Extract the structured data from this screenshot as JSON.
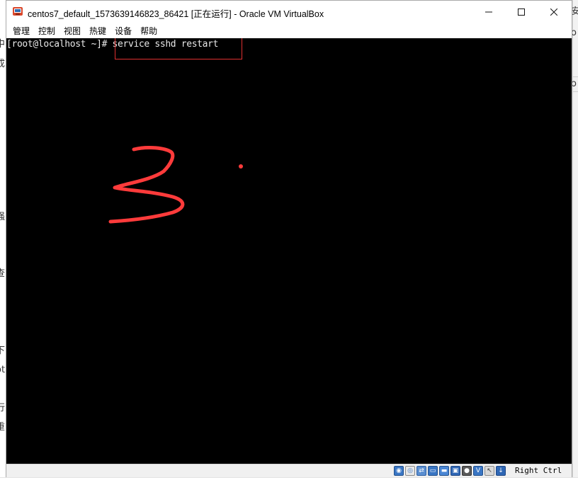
{
  "window": {
    "title": "centos7_default_1573639146823_86421 [正在运行] - Oracle VM VirtualBox",
    "minimize_icon": "minimize-icon",
    "maximize_icon": "maximize-icon",
    "close_icon": "close-icon"
  },
  "menu": {
    "items": [
      "管理",
      "控制",
      "视图",
      "热键",
      "设备",
      "帮助"
    ]
  },
  "terminal": {
    "prompt": "[root@localhost ~]# ",
    "command": "service sshd restart"
  },
  "annotation": {
    "color": "#ff3b3b",
    "number": "3"
  },
  "statusbar": {
    "host_key": "Right Ctrl",
    "icons": [
      "hard-disk-icon",
      "optical-drive-icon",
      "network-icon",
      "usb-icon",
      "shared-folders-icon",
      "display-icon",
      "video-capture-icon",
      "virtualization-icon",
      "mouse-integration-icon",
      "keyboard-icon"
    ]
  },
  "background": {
    "left_chars": [
      "中",
      "成",
      "强",
      "查",
      "下",
      "ot",
      "行",
      "重"
    ],
    "right_chars": [
      "安",
      "o",
      "2"
    ]
  }
}
